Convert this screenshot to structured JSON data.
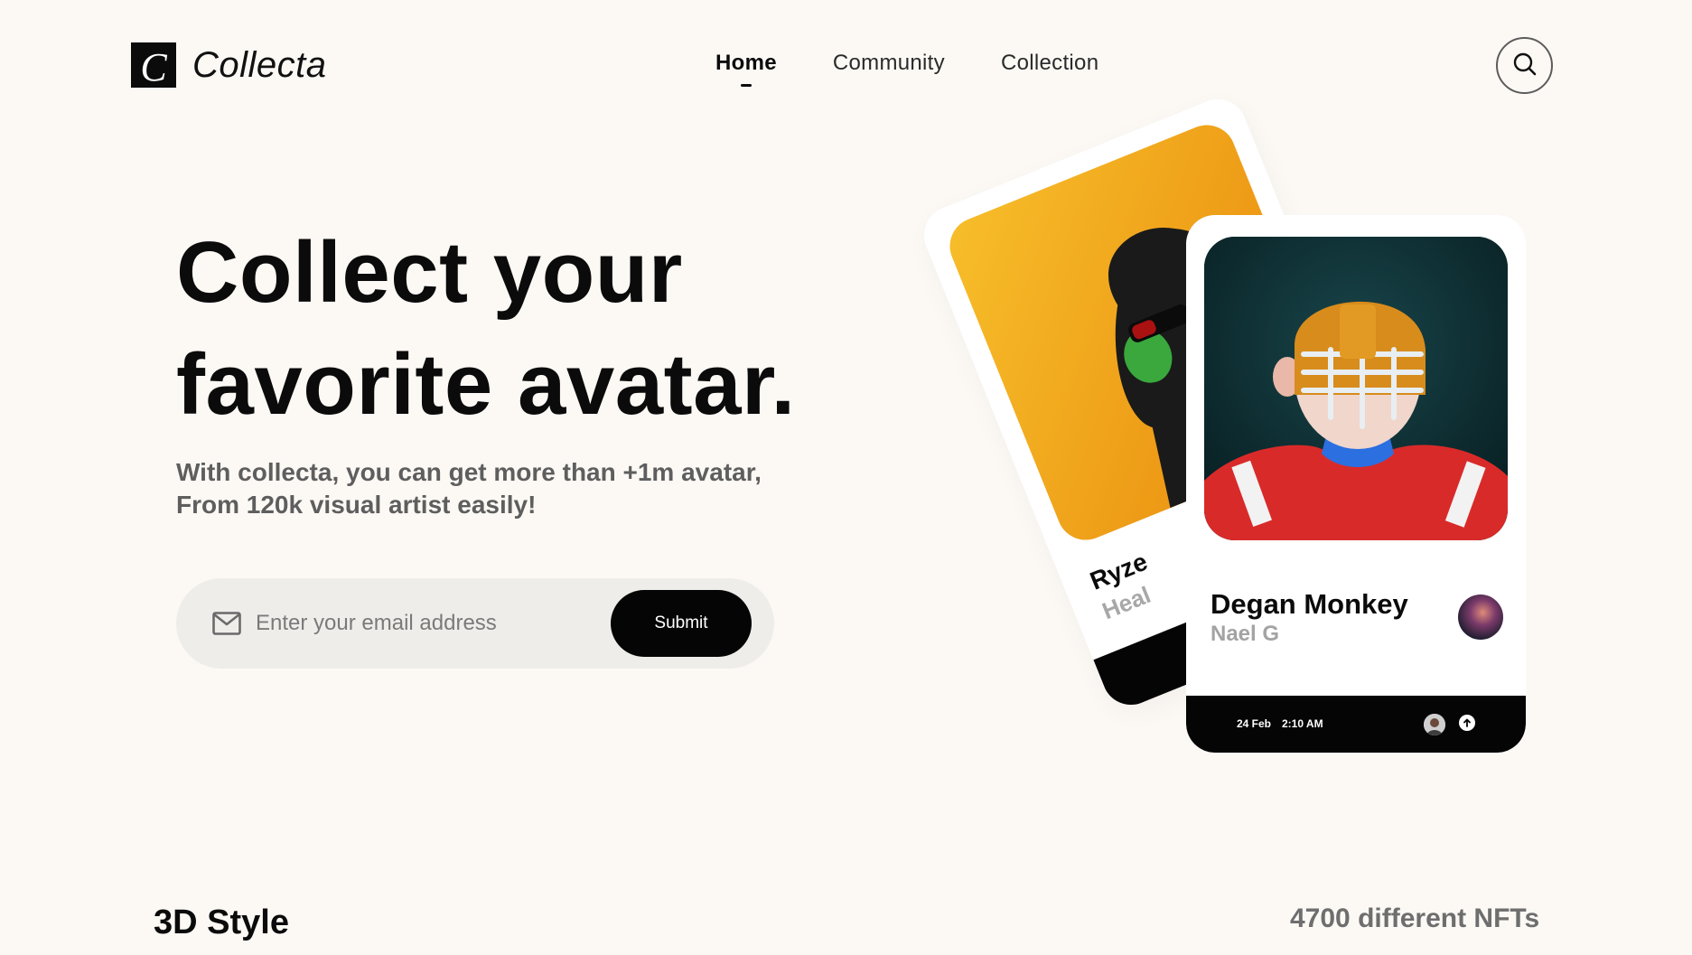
{
  "brand": {
    "name": "Collecta",
    "mark": "C",
    "icon": "collecta-logo-icon"
  },
  "nav": {
    "items": [
      {
        "label": "Home",
        "active": true
      },
      {
        "label": "Community",
        "active": false
      },
      {
        "label": "Collection",
        "active": false
      }
    ],
    "search_icon": "search-icon"
  },
  "hero": {
    "title_line1": "Collect your",
    "title_line2": "favorite avatar.",
    "subtitle_line1": "With collecta, you can get more than +1m avatar,",
    "subtitle_line2": "From 120k visual artist easily!"
  },
  "email_form": {
    "placeholder": "Enter your email address",
    "value": "",
    "submit_label": "Submit",
    "icon": "mail-icon"
  },
  "cards": {
    "back": {
      "title": "Ryze",
      "author": "Heal",
      "image_bg": "#f0a414"
    },
    "front": {
      "title": "Degan Monkey",
      "author": "Nael G",
      "date": "24 Feb",
      "time": "2:10 AM",
      "image_bg": "#0d2b30",
      "up_icon": "arrow-up-icon"
    }
  },
  "section": {
    "title": "3D Style",
    "count": "4700 different NFTs"
  },
  "colors": {
    "background": "#fcf9f5",
    "primary": "#050505",
    "muted": "#6e6e6e",
    "input_bg": "#efedea"
  }
}
